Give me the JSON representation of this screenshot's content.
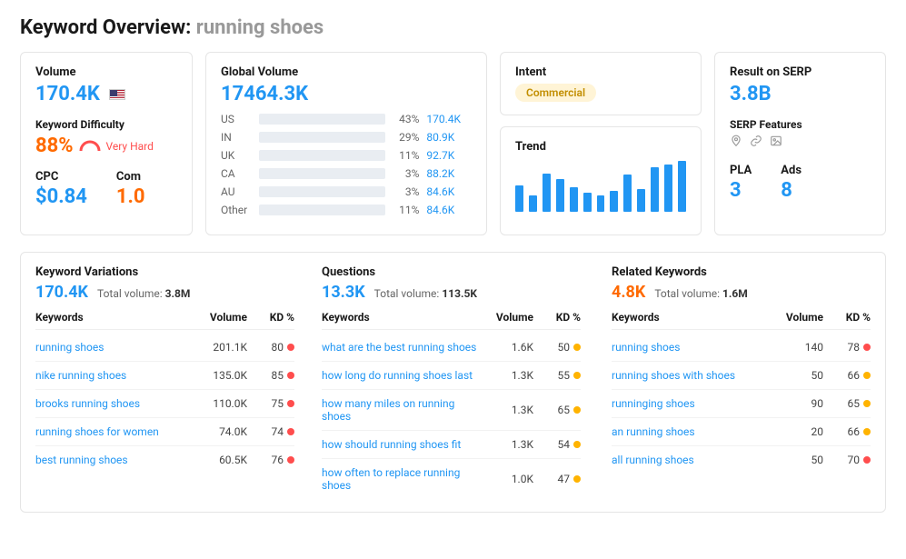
{
  "header": {
    "title": "Keyword Overview:",
    "query": "running shoes"
  },
  "volume": {
    "label": "Volume",
    "value": "170.4K"
  },
  "kd": {
    "label": "Keyword Difficulty",
    "value": "88%",
    "hardness": "Very Hard"
  },
  "cpc": {
    "label": "CPC",
    "value": "$0.84"
  },
  "com": {
    "label": "Com",
    "value": "1.0"
  },
  "global": {
    "label": "Global Volume",
    "value": "17464.3K",
    "rows": [
      {
        "cc": "US",
        "pct": "43%",
        "val": "170.4K",
        "w": 43
      },
      {
        "cc": "IN",
        "pct": "29%",
        "val": "80.9K",
        "w": 29
      },
      {
        "cc": "UK",
        "pct": "11%",
        "val": "92.7K",
        "w": 11
      },
      {
        "cc": "CA",
        "pct": "3%",
        "val": "88.2K",
        "w": 3
      },
      {
        "cc": "AU",
        "pct": "3%",
        "val": "84.6K",
        "w": 3
      },
      {
        "cc": "Other",
        "pct": "11%",
        "val": "84.6K",
        "w": 11
      }
    ]
  },
  "intent": {
    "label": "Intent",
    "value": "Commercial"
  },
  "trend": {
    "label": "Trend",
    "bars": [
      42,
      26,
      60,
      52,
      38,
      30,
      26,
      33,
      58,
      36,
      70,
      74,
      80
    ]
  },
  "serp": {
    "label": "Result on SERP",
    "value": "3.8B"
  },
  "features": {
    "label": "SERP Features",
    "icons": [
      "pin-icon",
      "link-icon",
      "picture-icon"
    ]
  },
  "pla": {
    "label": "PLA",
    "value": "3"
  },
  "ads": {
    "label": "Ads",
    "value": "8"
  },
  "variations": {
    "title": "Keyword Variations",
    "main": "170.4K",
    "sublabel": "Total volume:",
    "subval": "3.8M",
    "headers": {
      "kw": "Keywords",
      "vol": "Volume",
      "kd": "KD %"
    },
    "rows": [
      {
        "kw": "running shoes",
        "vol": "201.1K",
        "kd": "80",
        "dot": "red"
      },
      {
        "kw": "nike running shoes",
        "vol": "135.0K",
        "kd": "85",
        "dot": "red"
      },
      {
        "kw": "brooks running shoes",
        "vol": "110.0K",
        "kd": "75",
        "dot": "red"
      },
      {
        "kw": "running shoes for women",
        "vol": "74.0K",
        "kd": "74",
        "dot": "red"
      },
      {
        "kw": "best running shoes",
        "vol": "60.5K",
        "kd": "76",
        "dot": "red"
      }
    ]
  },
  "questions": {
    "title": "Questions",
    "main": "13.3K",
    "sublabel": "Total volume:",
    "subval": "113.5K",
    "headers": {
      "kw": "Keywords",
      "vol": "Volume",
      "kd": "KD %"
    },
    "rows": [
      {
        "kw": "what are the best running shoes",
        "vol": "1.6K",
        "kd": "50",
        "dot": "orange"
      },
      {
        "kw": "how long do running shoes last",
        "vol": "1.3K",
        "kd": "55",
        "dot": "orange"
      },
      {
        "kw": "how many miles on running shoes",
        "vol": "1.3K",
        "kd": "65",
        "dot": "orange"
      },
      {
        "kw": "how should running shoes fit",
        "vol": "1.3K",
        "kd": "54",
        "dot": "orange"
      },
      {
        "kw": "how often to replace running shoes",
        "vol": "1.0K",
        "kd": "47",
        "dot": "orange"
      }
    ]
  },
  "related": {
    "title": "Related Keywords",
    "main": "4.8K",
    "sublabel": "Total volume:",
    "subval": "1.6M",
    "headers": {
      "kw": "Keywords",
      "vol": "Volume",
      "kd": "KD %"
    },
    "rows": [
      {
        "kw": "running shoes",
        "vol": "140",
        "kd": "78",
        "dot": "red"
      },
      {
        "kw": "running shoes with shoes",
        "vol": "50",
        "kd": "66",
        "dot": "orange"
      },
      {
        "kw": "runninging shoes",
        "vol": "90",
        "kd": "65",
        "dot": "orange"
      },
      {
        "kw": "an running shoes",
        "vol": "20",
        "kd": "66",
        "dot": "orange"
      },
      {
        "kw": "all running shoes",
        "vol": "50",
        "kd": "70",
        "dot": "red"
      }
    ]
  },
  "chart_data": {
    "type": "bar",
    "title": "Trend",
    "values": [
      42,
      26,
      60,
      52,
      38,
      30,
      26,
      33,
      58,
      36,
      70,
      74,
      80
    ],
    "ylim": [
      0,
      100
    ]
  }
}
